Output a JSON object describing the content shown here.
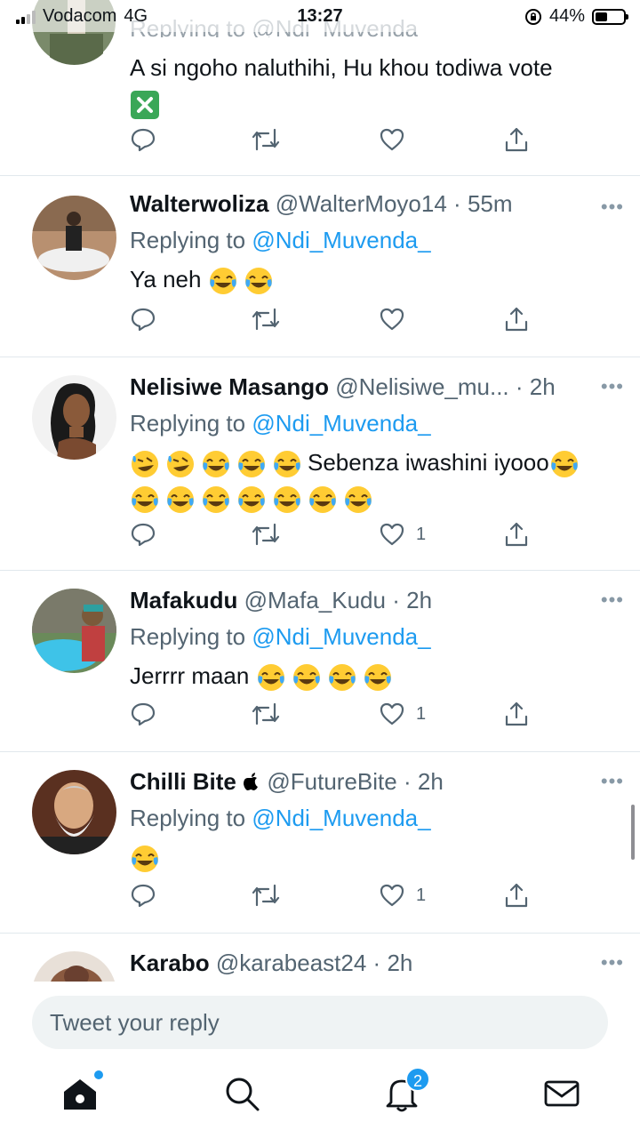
{
  "status_bar": {
    "carrier": "Vodacom",
    "network": "4G",
    "time": "13:27",
    "battery": "44%",
    "battery_level": 0.44
  },
  "colors": {
    "accent": "#1d9bf0",
    "text": "#0f1419",
    "muted": "#536471",
    "divider": "#e1e8ed"
  },
  "feed": {
    "partial_top": {
      "replying_partial": "Replying to @Ndi_Muvenda_",
      "text": "A si ngoho naluthihi, Hu khou todiwa vote",
      "emoji": "cross-mark-emoji"
    },
    "tweets": [
      {
        "name": "Walterwoliza",
        "handle": "@WalterMoyo14",
        "time": "55m",
        "replying_prefix": "Replying to ",
        "replying_to": "@Ndi_Muvenda_",
        "text": "Ya neh",
        "likes": ""
      },
      {
        "name": "Nelisiwe Masango",
        "handle": "@Nelisiwe_mu...",
        "time": "2h",
        "replying_prefix": "Replying to ",
        "replying_to": "@Ndi_Muvenda_",
        "text": "Sebenza iwashini iyooo",
        "likes": "1"
      },
      {
        "name": "Mafakudu",
        "handle": "@Mafa_Kudu",
        "time": "2h",
        "replying_prefix": "Replying to ",
        "replying_to": "@Ndi_Muvenda_",
        "text": "Jerrrr maan",
        "likes": "1"
      },
      {
        "name": "Chilli Bite",
        "handle": "@FutureBite",
        "time": "2h",
        "replying_prefix": "Replying to ",
        "replying_to": "@Ndi_Muvenda_",
        "text": "",
        "likes": "1"
      },
      {
        "name": "Karabo",
        "handle": "@karabeast24",
        "time": "2h"
      }
    ]
  },
  "reply_bar": {
    "placeholder": "Tweet your reply"
  },
  "tab_bar": {
    "notifications_count": "2"
  }
}
